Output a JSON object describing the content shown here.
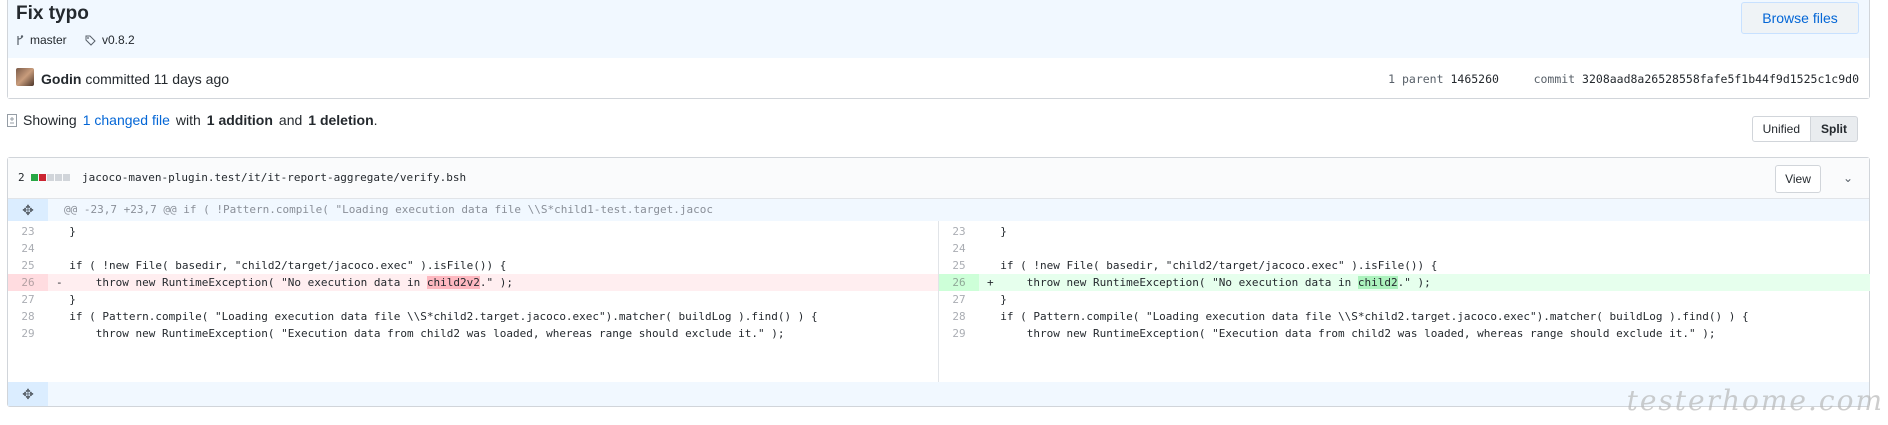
{
  "commit": {
    "title": "Fix typo",
    "branch": "master",
    "tag": "v0.8.2",
    "browse_label": "Browse files",
    "author": "Godin",
    "committed_text": "committed 11 days ago",
    "parent_label": "1 parent",
    "parent_sha": "1465260",
    "commit_label": "commit",
    "commit_sha": "3208aad8a26528558fafe5f1b44f9d1525c1c9d0"
  },
  "toc": {
    "showing": "Showing",
    "changed_link": "1 changed file",
    "with": "with",
    "additions": "1 addition",
    "and": "and",
    "deletions": "1 deletion",
    "period": ".",
    "unified_label": "Unified",
    "split_label": "Split"
  },
  "file": {
    "stat_count": "2",
    "filename": "jacoco-maven-plugin.test/it/it-report-aggregate/verify.bsh",
    "view_label": "View",
    "hunk_header": "@@ -23,7 +23,7 @@ if ( !Pattern.compile( \"Loading execution data file \\\\S*child1-test.target.jacoc",
    "left_lines": [
      {
        "num": "23",
        "type": "ctx",
        "code": "  }"
      },
      {
        "num": "24",
        "type": "ctx",
        "code": ""
      },
      {
        "num": "25",
        "type": "ctx",
        "code": "  if ( !new File( basedir, \"child2/target/jacoco.exec\" ).isFile()) {"
      },
      {
        "num": "26",
        "type": "del",
        "pre": "-     throw new RuntimeException( \"No execution data in ",
        "hl": "child2v2",
        "post": ".\" );"
      },
      {
        "num": "27",
        "type": "ctx",
        "code": "  }"
      },
      {
        "num": "28",
        "type": "ctx",
        "code": "  if ( Pattern.compile( \"Loading execution data file \\\\S*child2.target.jacoco.exec\").matcher( buildLog ).find() ) {"
      },
      {
        "num": "29",
        "type": "ctx",
        "code": "      throw new RuntimeException( \"Execution data from child2 was loaded, whereas range should exclude it.\" );"
      }
    ],
    "right_lines": [
      {
        "num": "23",
        "type": "ctx",
        "code": "  }"
      },
      {
        "num": "24",
        "type": "ctx",
        "code": ""
      },
      {
        "num": "25",
        "type": "ctx",
        "code": "  if ( !new File( basedir, \"child2/target/jacoco.exec\" ).isFile()) {"
      },
      {
        "num": "26",
        "type": "add",
        "pre": "+     throw new RuntimeException( \"No execution data in ",
        "hl": "child2",
        "post": ".\" );"
      },
      {
        "num": "27",
        "type": "ctx",
        "code": "  }"
      },
      {
        "num": "28",
        "type": "ctx",
        "code": "  if ( Pattern.compile( \"Loading execution data file \\\\S*child2.target.jacoco.exec\").matcher( buildLog ).find() ) {"
      },
      {
        "num": "29",
        "type": "ctx",
        "code": "      throw new RuntimeException( \"Execution data from child2 was loaded, whereas range should exclude it.\" );"
      }
    ]
  },
  "watermark": "testerhome.com",
  "colors": {
    "link": "#0366d6",
    "addition": "#28a745",
    "deletion": "#cb2431"
  },
  "icons": [
    "branch-icon",
    "tag-icon",
    "file-diff-icon",
    "expand-icon",
    "chevron-down-icon"
  ]
}
